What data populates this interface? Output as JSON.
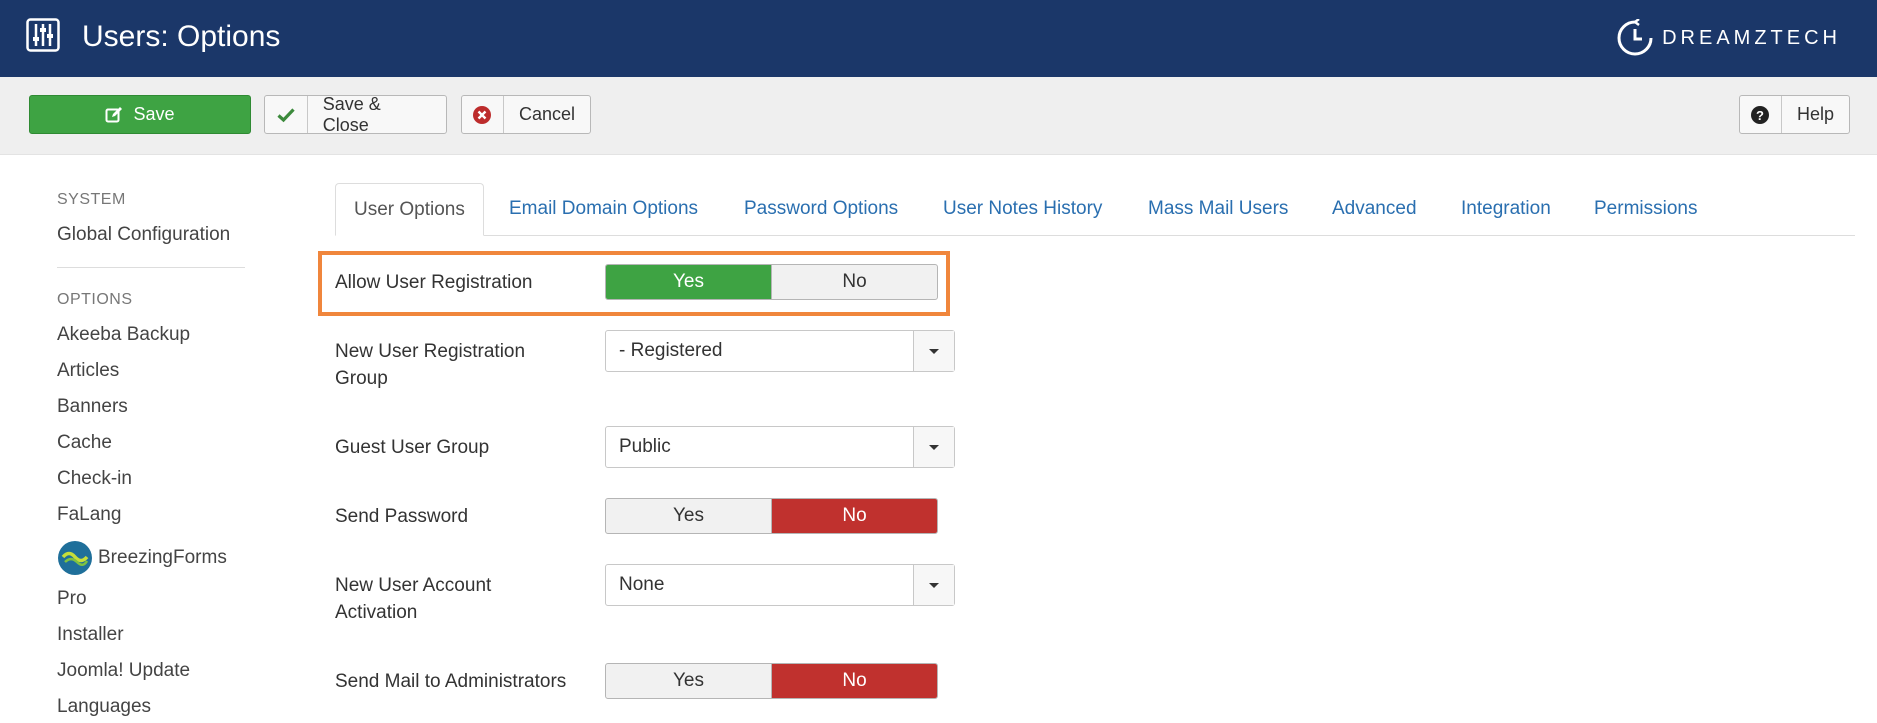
{
  "header": {
    "title": "Users: Options",
    "app_icon": "sliders-icon",
    "brand": "DREAMZTECH",
    "brand_icon": "clock-logo-icon",
    "background": "#1b3769"
  },
  "toolbar": {
    "save_label": "Save",
    "save_icon": "edit-icon",
    "save_close_label": "Save & Close",
    "save_close_icon": "check-icon",
    "cancel_label": "Cancel",
    "cancel_icon": "times-circle-icon",
    "help_label": "Help",
    "help_icon": "question-circle-icon",
    "save_color": "#3ea343"
  },
  "sidebar": {
    "system_heading": "SYSTEM",
    "system_items": [
      "Global Configuration"
    ],
    "options_heading": "OPTIONS",
    "options_items": [
      "Akeeba Backup",
      "Articles",
      "Banners",
      "Cache",
      "Check-in",
      "FaLang",
      "BreezingForms",
      "Pro",
      "Installer",
      "Joomla! Update",
      "Languages"
    ]
  },
  "tabs": [
    "User Options",
    "Email Domain Options",
    "Password Options",
    "User Notes History",
    "Mass Mail Users",
    "Advanced",
    "Integration",
    "Permissions"
  ],
  "active_tab": "User Options",
  "fields": {
    "allow_registration": {
      "label": "Allow User Registration",
      "yes": "Yes",
      "no": "No",
      "value": "Yes"
    },
    "registration_group": {
      "label": "New User Registration Group",
      "value": "- Registered"
    },
    "guest_group": {
      "label": "Guest User Group",
      "value": "Public"
    },
    "send_password": {
      "label": "Send Password",
      "yes": "Yes",
      "no": "No",
      "value": "No"
    },
    "account_activation": {
      "label": "New User Account Activation",
      "value": "None"
    },
    "mail_admins": {
      "label": "Send Mail to Administrators",
      "yes": "Yes",
      "no": "No",
      "value": "No"
    }
  },
  "colors": {
    "yes_active": "#3ea343",
    "no_active": "#c0312e",
    "highlight": "#f0863c",
    "link": "#2a6fb0"
  }
}
